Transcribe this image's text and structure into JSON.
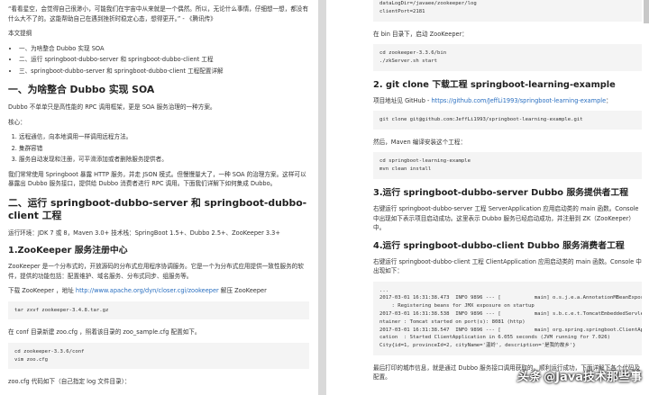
{
  "left": {
    "quote": "“看看星空，会觉得自己很渺小，可能我们在宇宙中从来就是一个偶然。所以，无论什么事情，仔细想一想，都没有什么大不了的。这能帮助自己在遇到挫折时稳定心态，想得更开。” - 《腾讯传》",
    "outline_label": "本文提纲",
    "outline": [
      "一、为啥整合 Dubbo 实现 SOA",
      "二、运行 springboot-dubbo-server 和 springboot-dubbo-client 工程",
      "三、springboot-dubbo-server 和 springboot-dubbo-client 工程配置详解"
    ],
    "h1a": "一、为啥整合 Dubbo 实现 SOA",
    "p1": "Dubbo 不单单只是高性能的 RPC 调用框架，更是 SOA 服务治理的一种方案。",
    "core_label": "核心：",
    "core": [
      "远程通信，向本地调用一样调用远程方法。",
      "集群容错",
      "服务自动发现和注册，可平滑添加或者删除服务提供者。"
    ],
    "p2": "我们常常使用 Springboot 暴露 HTTP 服务，并走 JSON 模式。但慢慢量大了，一种 SOA 的治理方案。这样可以暴露出 Dubbo 服务接口，提供给 Dubbo 消费者进行 RPC 调用。下面我们详解下如何集成 Dubbo。",
    "h1b": "二、运行 springboot-dubbo-server 和 springboot-dubbo-client 工程",
    "env": "运行环境：JDK 7 或 8，Maven 3.0+ 技术栈：SpringBoot 1.5+、Dubbo 2.5+、ZooKeeper 3.3+",
    "h2a": "1.ZooKeeper 服务注册中心",
    "p3": "ZooKeeper 是一个分布式的，开放源码的分布式应用程序协调服务。它是一个为分布式应用提供一致性服务的软件，提供的功能包括：配置维护、域名服务、分布式同步、组服务等。",
    "download_prefix": "下载 ZooKeeper ，地址 ",
    "download_link": "http://www.apache.org/dyn/closer.cgi/zookeeper",
    "download_suffix": " 解压 ZooKeeper",
    "code1": "tar zxvf zookeeper-3.4.8.tar.gz",
    "p4": "在 conf 目录新建 zoo.cfg ，照着该目录的 zoo_sample.cfg 配置如下。",
    "code2": "cd zookeeper-3.3.6/conf\nvim zoo.cfg",
    "p5": "zoo.cfg 代码如下（自己指定 log 文件目录）："
  },
  "right": {
    "code0": "dataLogDir=/javaee/zookeeper/log\nclientPort=2181",
    "p1": "在 bin 目录下，启动 ZooKeeper：",
    "code1": "cd zookeeper-3.3.6/bin\n./zkServer.sh start",
    "h2": "2. git clone 下载工程 springboot-learning-example",
    "p2_prefix": "项目地址见 GitHub - ",
    "p2_link": "https://github.com/JeffLi1993/springboot-learning-example",
    "p2_suffix": "：",
    "code2": "git clone git@github.com:JeffLi1993/springboot-learning-example.git",
    "p3": "然后，Maven 编译安装这个工程：",
    "code3": "cd springboot-learning-example\nmvn clean install",
    "h3": "3.运行 springboot-dubbo-server Dubbo 服务提供者工程",
    "p4": "右键运行 springboot-dubbo-server 工程 ServerApplication 应用启动类的 main 函数。Console 中出现如下表示项目启动成功。这里表示 Dubbo 服务已经启动成功，并注册到 ZK（ZooKeeper）中。",
    "h4": "4.运行 springboot-dubbo-client Dubbo 服务消费者工程",
    "p5": "右键运行 springboot-dubbo-client 工程 ClientApplication 应用启动类的 main 函数。Console 中出现如下：",
    "code4": "...\n2017-03-01 16:31:38.473  INFO 9896 --- [           main] o.s.j.e.a.AnnotationMBeanExporter\n    : Registering beans for JMX exposure on startup\n2017-03-01 16:31:38.538  INFO 9896 --- [           main] s.b.c.e.t.TomcatEmbeddedServletCo\nntainer : Tomcat started on port(s): 8081 (http)\n2017-03-01 16:31:38.547  INFO 9896 --- [           main] org.spring.springboot.ClientAppli\ncation  : Started ClientApplication in 6.055 seconds (JVM running for 7.026)\nCity{id=1, provinceId=2, cityName='温岭', description='是我的故乡'}",
    "p6": "最后打印的城市信息，就是通过 Dubbo 服务接口调用获取的。顺利运行成功，下面详解下各个代码及配置。"
  },
  "watermark": {
    "logo": "头条",
    "text": "@Java技术那些事"
  }
}
